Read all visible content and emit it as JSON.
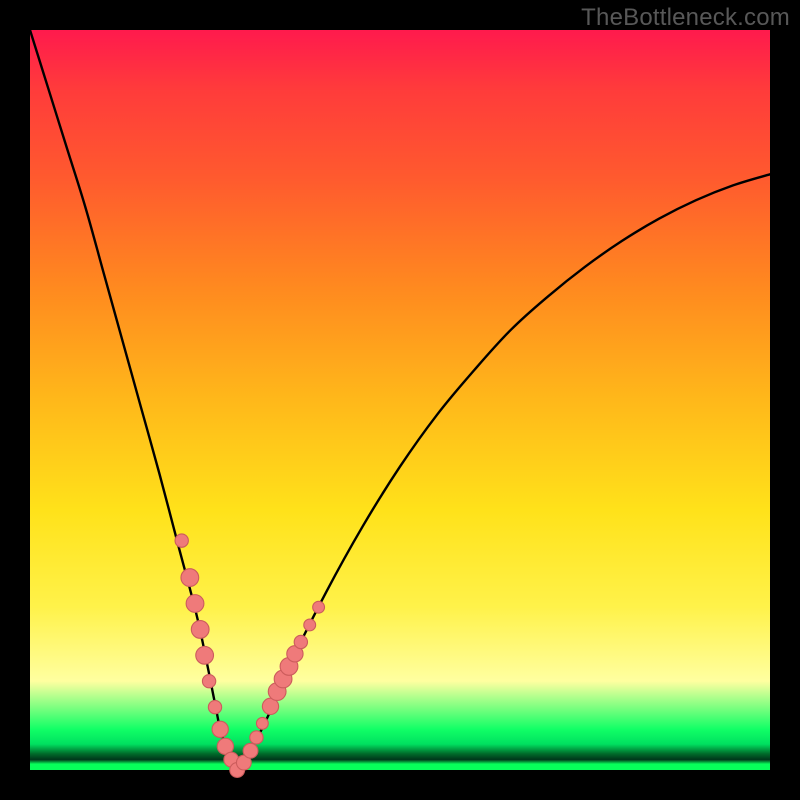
{
  "watermark": "TheBottleneck.com",
  "colors": {
    "curve": "#000000",
    "marker_fill": "#ef7a7a",
    "marker_stroke": "#cc5c5c",
    "bg": "#000000"
  },
  "chart_data": {
    "type": "line",
    "title": "",
    "xlabel": "",
    "ylabel": "",
    "xlim": [
      0,
      100
    ],
    "ylim": [
      0,
      100
    ],
    "grid": false,
    "series": [
      {
        "name": "bottleneck-curve",
        "x": [
          0,
          2.5,
          5,
          7.5,
          10,
          12.5,
          15,
          17.5,
          20,
          22.5,
          24,
          25,
          26,
          28,
          30,
          32.5,
          35,
          40,
          45,
          50,
          55,
          60,
          65,
          70,
          75,
          80,
          85,
          90,
          95,
          100
        ],
        "values": [
          100,
          92,
          84,
          76,
          67,
          58,
          49,
          40,
          30.5,
          21,
          14,
          9,
          4.5,
          0,
          3,
          8,
          14,
          24,
          33,
          41,
          48,
          54,
          59.5,
          64,
          68,
          71.5,
          74.5,
          77,
          79,
          80.5
        ]
      }
    ],
    "markers": [
      {
        "x": 20.5,
        "y": 31,
        "r": 0.9
      },
      {
        "x": 21.6,
        "y": 26,
        "r": 1.2
      },
      {
        "x": 22.3,
        "y": 22.5,
        "r": 1.2
      },
      {
        "x": 23.0,
        "y": 19,
        "r": 1.2
      },
      {
        "x": 23.6,
        "y": 15.5,
        "r": 1.2
      },
      {
        "x": 24.2,
        "y": 12,
        "r": 0.9
      },
      {
        "x": 25.0,
        "y": 8.5,
        "r": 0.9
      },
      {
        "x": 25.7,
        "y": 5.5,
        "r": 1.1
      },
      {
        "x": 26.4,
        "y": 3.2,
        "r": 1.1
      },
      {
        "x": 27.2,
        "y": 1.4,
        "r": 1.0
      },
      {
        "x": 28.0,
        "y": 0.0,
        "r": 1.0
      },
      {
        "x": 28.9,
        "y": 1.0,
        "r": 1.0
      },
      {
        "x": 29.8,
        "y": 2.6,
        "r": 1.0
      },
      {
        "x": 30.6,
        "y": 4.4,
        "r": 0.9
      },
      {
        "x": 31.4,
        "y": 6.3,
        "r": 0.8
      },
      {
        "x": 32.5,
        "y": 8.6,
        "r": 1.1
      },
      {
        "x": 33.4,
        "y": 10.6,
        "r": 1.2
      },
      {
        "x": 34.2,
        "y": 12.3,
        "r": 1.2
      },
      {
        "x": 35.0,
        "y": 14.0,
        "r": 1.2
      },
      {
        "x": 35.8,
        "y": 15.7,
        "r": 1.1
      },
      {
        "x": 36.6,
        "y": 17.3,
        "r": 0.9
      },
      {
        "x": 37.8,
        "y": 19.6,
        "r": 0.8
      },
      {
        "x": 39.0,
        "y": 22.0,
        "r": 0.8
      }
    ]
  }
}
